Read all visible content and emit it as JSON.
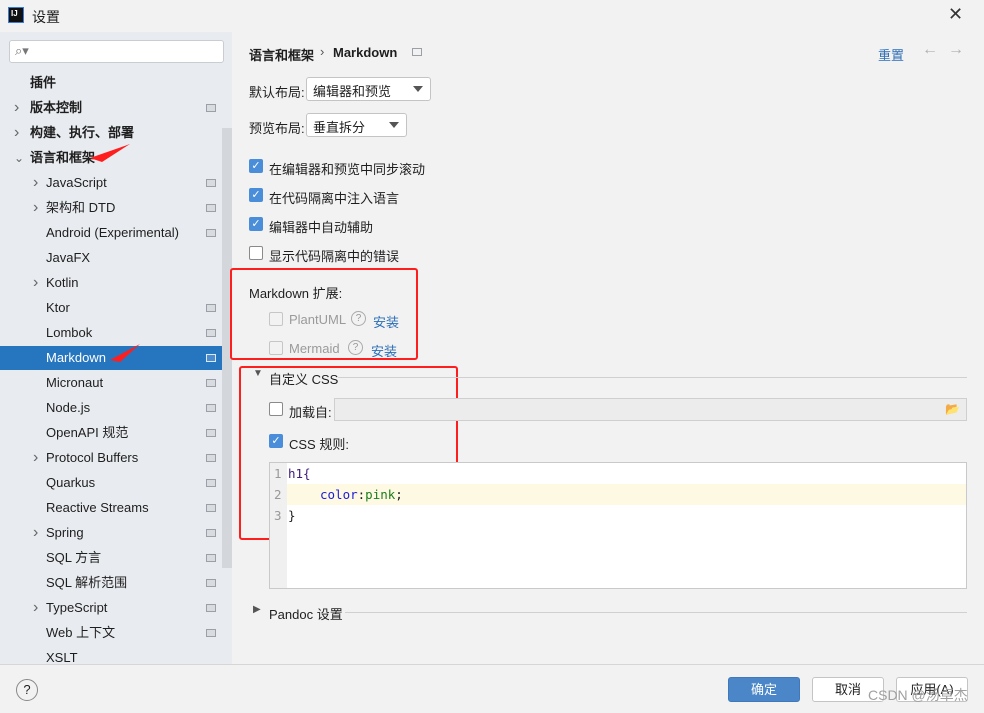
{
  "window": {
    "title": "设置",
    "logo": "IJ",
    "close": "✕"
  },
  "sidebar": {
    "search_placeholder": "",
    "items": [
      {
        "label": "插件",
        "level": 0,
        "arrow": "",
        "badge": false,
        "bold": true
      },
      {
        "label": "版本控制",
        "level": 0,
        "arrow": "right",
        "badge": true,
        "bold": true
      },
      {
        "label": "构建、执行、部署",
        "level": 0,
        "arrow": "right",
        "badge": false,
        "bold": true
      },
      {
        "label": "语言和框架",
        "level": 0,
        "arrow": "down",
        "badge": false,
        "bold": true
      },
      {
        "label": "JavaScript",
        "level": 1,
        "arrow": "right",
        "badge": true
      },
      {
        "label": "架构和 DTD",
        "level": 1,
        "arrow": "right",
        "badge": true
      },
      {
        "label": "Android (Experimental)",
        "level": 1,
        "arrow": "",
        "badge": true
      },
      {
        "label": "JavaFX",
        "level": 1,
        "arrow": "",
        "badge": false
      },
      {
        "label": "Kotlin",
        "level": 1,
        "arrow": "right",
        "badge": false
      },
      {
        "label": "Ktor",
        "level": 1,
        "arrow": "",
        "badge": true
      },
      {
        "label": "Lombok",
        "level": 1,
        "arrow": "",
        "badge": true
      },
      {
        "label": "Markdown",
        "level": 1,
        "arrow": "",
        "badge": true,
        "selected": true
      },
      {
        "label": "Micronaut",
        "level": 1,
        "arrow": "",
        "badge": true
      },
      {
        "label": "Node.js",
        "level": 1,
        "arrow": "",
        "badge": true
      },
      {
        "label": "OpenAPI 规范",
        "level": 1,
        "arrow": "",
        "badge": true
      },
      {
        "label": "Protocol Buffers",
        "level": 1,
        "arrow": "right",
        "badge": true
      },
      {
        "label": "Quarkus",
        "level": 1,
        "arrow": "",
        "badge": true
      },
      {
        "label": "Reactive Streams",
        "level": 1,
        "arrow": "",
        "badge": true
      },
      {
        "label": "Spring",
        "level": 1,
        "arrow": "right",
        "badge": true
      },
      {
        "label": "SQL 方言",
        "level": 1,
        "arrow": "",
        "badge": true
      },
      {
        "label": "SQL 解析范围",
        "level": 1,
        "arrow": "",
        "badge": true
      },
      {
        "label": "TypeScript",
        "level": 1,
        "arrow": "right",
        "badge": true
      },
      {
        "label": "Web 上下文",
        "level": 1,
        "arrow": "",
        "badge": true
      },
      {
        "label": "XSLT",
        "level": 1,
        "arrow": "",
        "badge": false
      }
    ]
  },
  "main": {
    "breadcrumb": {
      "parent": "语言和框架",
      "sep": "›",
      "current": "Markdown"
    },
    "reset": "重置",
    "back": "←",
    "forward": "→",
    "default_layout": {
      "label": "默认布局:",
      "value": "编辑器和预览"
    },
    "preview_layout": {
      "label": "预览布局:",
      "value": "垂直拆分"
    },
    "checks": [
      {
        "label": "在编辑器和预览中同步滚动",
        "checked": true
      },
      {
        "label": "在代码隔离中注入语言",
        "checked": true
      },
      {
        "label": "编辑器中自动辅助",
        "checked": true
      },
      {
        "label": "显示代码隔离中的错误",
        "checked": false
      }
    ],
    "extensions": {
      "title": "Markdown 扩展:",
      "items": [
        {
          "label": "PlantUML",
          "install": "安装"
        },
        {
          "label": "Mermaid",
          "install": "安装"
        }
      ]
    },
    "custom_css": {
      "title": "自定义 CSS",
      "load_from": "加载自:",
      "load_checked": false,
      "load_value": "",
      "rules_label": "CSS 规则:",
      "rules_checked": true,
      "code": [
        {
          "n": "1",
          "text": "h1{"
        },
        {
          "n": "2",
          "prop": "color",
          "colon": ":",
          "val": "pink",
          "semi": ";"
        },
        {
          "n": "3",
          "text": "}"
        }
      ]
    },
    "pandoc": "Pandoc 设置"
  },
  "footer": {
    "help": "?",
    "ok": "确定",
    "cancel": "取消",
    "apply": "应用(A)",
    "watermark": "CSDN @汤卓杰"
  },
  "colors": {
    "accent": "#2675bf",
    "annotation": "#ff1e1e"
  }
}
